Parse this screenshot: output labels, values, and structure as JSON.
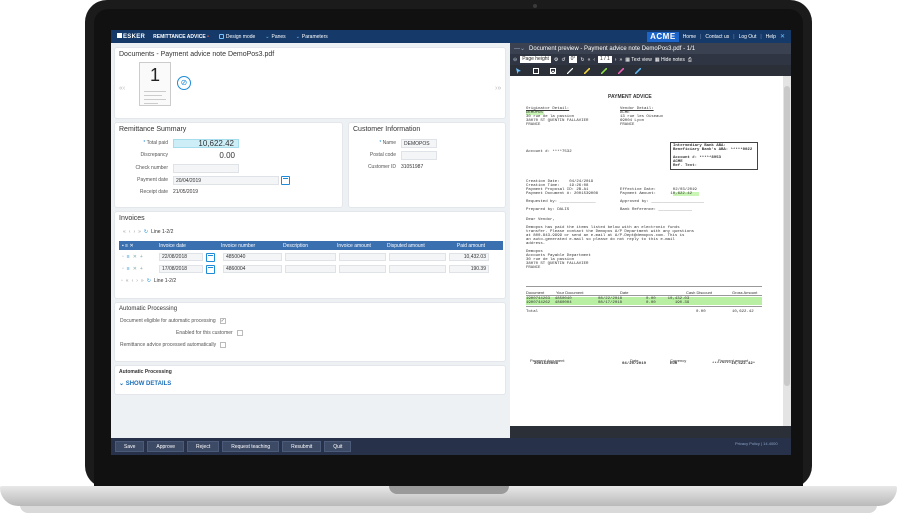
{
  "header": {
    "logo": "ESKER",
    "app_title": "REMITTANCE ADVICE",
    "menus": [
      "Design mode",
      "Panes",
      "Parameters"
    ],
    "brand": "ACME",
    "links": [
      "Home",
      "Contact us",
      "Log Out",
      "Help"
    ]
  },
  "document": {
    "title": "Documents - Payment advice note DemoPos3.pdf",
    "thumb_number": "1"
  },
  "summary": {
    "title": "Remittance Summary",
    "fields": [
      {
        "label": "Total paid",
        "value": "10,622.42"
      },
      {
        "label": "Discrepancy",
        "value": "0.00"
      },
      {
        "label": "Check number",
        "value": ""
      },
      {
        "label": "Payment date",
        "value": "20/04/2019"
      },
      {
        "label": "Receipt date",
        "value": "21/05/2019"
      }
    ]
  },
  "customer": {
    "title": "Customer Information",
    "fields": [
      {
        "label": "Name",
        "value": "DEMOPOS"
      },
      {
        "label": "Postal code",
        "value": ""
      },
      {
        "label": "Customer ID",
        "value": "31051987"
      }
    ]
  },
  "invoices": {
    "title": "Invoices",
    "line_top": "Line 1-2/2",
    "line_bottom": "Line 1-2/2",
    "columns": [
      "Invoice date",
      "Invoice number",
      "Description",
      "Invoice amount",
      "Disputed amount",
      "Paid amount"
    ],
    "rows": [
      {
        "date": "22/08/2018",
        "number": "4850040",
        "desc": "",
        "amount": "",
        "disputed": "",
        "paid": "10,432.03"
      },
      {
        "date": "17/08/2018",
        "number": "4860004",
        "desc": "",
        "amount": "",
        "disputed": "",
        "paid": "190.39"
      }
    ]
  },
  "automatic": {
    "title": "Automatic Processing",
    "items": [
      {
        "label": "Document eligible for automatic processing",
        "checked": true
      },
      {
        "label": "Enabled for this customer",
        "checked": false
      },
      {
        "label": "Remittance advice processed automatically",
        "checked": false
      }
    ]
  },
  "automatic2": {
    "title": "Automatic Processing",
    "show_details": "SHOW DETAILS"
  },
  "footer": {
    "buttons": [
      "Save",
      "Approve",
      "Reject",
      "Request teaching",
      "Resubmit",
      "Quit"
    ],
    "privacy": "Privacy Policy | 14.4000"
  },
  "preview": {
    "title": "Document preview - Payment advice note DemoPos3.pdf - 1/1",
    "page_mode": "Page height",
    "rotation": "0°",
    "page_counter": "1 / 1",
    "text_view": "Text view",
    "hide_notes": "Hide notes",
    "pdf": {
      "heading": "PAYMENT ADVICE",
      "originator_label": "Originator Detail:",
      "originator": [
        "DEMOPOS",
        "30 rue de la passion",
        "38070 ST QUENTIN FALLAVIER",
        "FRANCE"
      ],
      "vendor_label": "Vendor Detail:",
      "vendor": [
        "ACME",
        "13 rue les Oiseaux",
        "69004 Lyon",
        "FRANCE"
      ],
      "account_left": "Account #: ****7532",
      "bank_box": [
        "Intermediary Bank ABA:",
        "Beneficiary Bank's ABA: *****0022",
        "",
        "Account #: *****8953",
        "ACME",
        "Ref. Text:"
      ],
      "creation_date": "Creation Date:    04/24/2019",
      "creation_time": "Creation Time:    19:26:08",
      "proposal_id": "Payment Proposal ID: 2B-A1",
      "payment_doc": "Payment Document #: 2001539008",
      "effective_date": "Effective Date:       02/03/2019",
      "payment_amount": "Payment Amount:      10,622.42",
      "requested": "Requested by: _______________",
      "approved": "Approved by: ______________________",
      "prepared": "Prepared by: DALIS",
      "bank_ref": "Bank Reference: ______________",
      "dear": "Dear Vendor,",
      "body": [
        "Demopos has paid the items listed below with an electronic funds",
        "transfer. Please contact the Demopos A/P Department with any questions",
        "at 800-843-9999 or send an e-mail at A/P.Dept@demopos.com. This is",
        "an auto-generated e-mail so please do not reply to this e-mail",
        "address."
      ],
      "sign": [
        "Demopos",
        "Accounts Payable Department",
        "30 rue de la passion",
        "38070 ST QUENTIN FALLAVIER",
        "FRANCE"
      ],
      "table_head": [
        "Document",
        "Your Document",
        "Date",
        "Cash Discount",
        "Gross Amount"
      ],
      "table_rows": [
        "1900744263  4850040           08/22/2018          0.00     10,432.03",
        "1900744262  4860004           08/17/2018          0.00        190.39"
      ],
      "total_label": "Total",
      "total_disc": "0.00",
      "total_amount": "10,622.42",
      "foot_head": [
        "Payment document",
        "Date",
        "Currency",
        "Payment amount"
      ],
      "foot_vals": [
        "2001539008",
        "04/20/2019",
        "EUR",
        "********10,622.42*"
      ]
    }
  }
}
